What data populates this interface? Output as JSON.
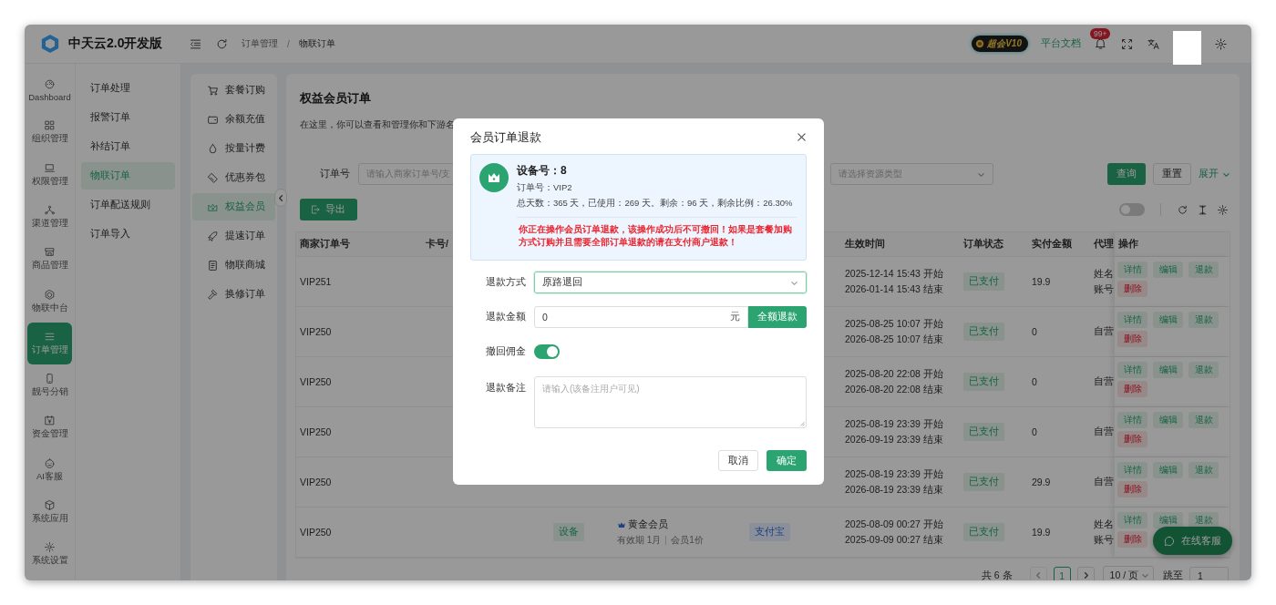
{
  "app": {
    "title": "中天云2.0开发版"
  },
  "header": {
    "breadcrumb": [
      "订单管理",
      "物联订单"
    ],
    "breadcrumb_separator": "/",
    "vip_badge": "超会V10",
    "docs_link": "平台文档",
    "notification_count": "99+"
  },
  "nav": [
    {
      "label": "Dashboard",
      "selected": false
    },
    {
      "label": "组织管理",
      "selected": false
    },
    {
      "label": "权限管理",
      "selected": false
    },
    {
      "label": "渠道管理",
      "selected": false
    },
    {
      "label": "商品管理",
      "selected": false
    },
    {
      "label": "物联中台",
      "selected": false
    },
    {
      "label": "订单管理",
      "selected": true
    },
    {
      "label": "靓号分销",
      "selected": false
    },
    {
      "label": "资金管理",
      "selected": false
    },
    {
      "label": "AI客服",
      "selected": false
    },
    {
      "label": "系统应用",
      "selected": false
    },
    {
      "label": "系统设置",
      "selected": false
    }
  ],
  "submenu": [
    {
      "label": "订单处理",
      "selected": false
    },
    {
      "label": "报警订单",
      "selected": false
    },
    {
      "label": "补结订单",
      "selected": false
    },
    {
      "label": "物联订单",
      "selected": true
    },
    {
      "label": "订单配送规则",
      "selected": false
    },
    {
      "label": "订单导入",
      "selected": false
    }
  ],
  "order_types": [
    {
      "label": "套餐订购",
      "selected": false
    },
    {
      "label": "余额充值",
      "selected": false
    },
    {
      "label": "按量计费",
      "selected": false
    },
    {
      "label": "优惠券包",
      "selected": false
    },
    {
      "label": "权益会员",
      "selected": true
    },
    {
      "label": "提速订单",
      "selected": false
    },
    {
      "label": "物联商城",
      "selected": false
    },
    {
      "label": "换修订单",
      "selected": false
    }
  ],
  "page": {
    "title": "权益会员订单",
    "description": "在这里，你可以查看和管理你和下游名"
  },
  "filters": {
    "order_label": "订单号",
    "order_placeholder": "请输入商家订单号/支",
    "resource_placeholder": "请选择资源类型",
    "search_button": "查询",
    "reset_button": "重置",
    "expand_link": "展开"
  },
  "toolbar": {
    "export_button": "导出",
    "toggle_on": false
  },
  "table": {
    "columns": {
      "order_no": "商家订单号",
      "card_no": "卡号/",
      "effective_time": "生效时间",
      "status": "订单状态",
      "paid": "实付金额",
      "agent": "代理",
      "actions": "操作"
    },
    "rows": [
      {
        "order_no": "VIP251",
        "start": "2025-12-14 15:43 开始",
        "end": "2026-01-14 15:43 结束",
        "status": "已支付",
        "paid": "19.9",
        "agent": [
          "姓名",
          "账号"
        ],
        "actions": [
          {
            "label": "详情",
            "kind": "normal"
          },
          {
            "label": "编辑",
            "kind": "normal"
          },
          {
            "label": "退款",
            "kind": "normal"
          },
          {
            "label": "删除",
            "kind": "danger"
          }
        ]
      },
      {
        "order_no": "VIP250",
        "start": "2025-08-25 10:07 开始",
        "end": "2026-08-25 10:07 结束",
        "status": "已支付",
        "paid": "0",
        "agent": [
          "自营"
        ],
        "actions": [
          {
            "label": "详情",
            "kind": "normal"
          },
          {
            "label": "编辑",
            "kind": "normal"
          },
          {
            "label": "退款",
            "kind": "normal"
          },
          {
            "label": "删除",
            "kind": "danger"
          }
        ]
      },
      {
        "order_no": "VIP250",
        "start": "2025-08-20 22:08 开始",
        "end": "2026-08-20 22:08 结束",
        "status": "已支付",
        "paid": "0",
        "agent": [
          "自营"
        ],
        "actions": [
          {
            "label": "详情",
            "kind": "normal"
          },
          {
            "label": "编辑",
            "kind": "normal"
          },
          {
            "label": "退款",
            "kind": "normal"
          },
          {
            "label": "删除",
            "kind": "danger"
          }
        ]
      },
      {
        "order_no": "VIP250",
        "start": "2025-08-19 23:39 开始",
        "end": "2026-09-19 23:39 结束",
        "status": "已支付",
        "paid": "0",
        "agent": [
          "自营"
        ],
        "actions": [
          {
            "label": "详情",
            "kind": "normal"
          },
          {
            "label": "编辑",
            "kind": "normal"
          },
          {
            "label": "退款",
            "kind": "normal"
          },
          {
            "label": "删除",
            "kind": "danger"
          }
        ]
      },
      {
        "order_no": "VIP250",
        "start": "2025-08-19 23:39 开始",
        "end": "2026-08-19 23:39 结束",
        "status": "已支付",
        "paid": "29.9",
        "agent": [
          "自营"
        ],
        "actions": [
          {
            "label": "详情",
            "kind": "normal"
          },
          {
            "label": "编辑",
            "kind": "normal"
          },
          {
            "label": "退款",
            "kind": "normal"
          },
          {
            "label": "删除",
            "kind": "danger"
          }
        ]
      },
      {
        "order_no": "VIP250",
        "type": "设备",
        "package": {
          "name": "黄金会员",
          "validity": "有效期 1月",
          "price": "会员1价"
        },
        "payment": "支付宝",
        "start": "2025-08-09 00:27 开始",
        "end": "2025-09-09 00:27 结束",
        "status": "已支付",
        "paid": "19.9",
        "agent": [
          "姓名",
          "账号"
        ],
        "actions": [
          {
            "label": "详情",
            "kind": "normal"
          },
          {
            "label": "编辑",
            "kind": "normal"
          },
          {
            "label": "退款",
            "kind": "normal"
          },
          {
            "label": "删除",
            "kind": "danger"
          }
        ]
      }
    ]
  },
  "pagination": {
    "total": "共 6 条",
    "pages": [
      {
        "label": "1",
        "selected": true
      }
    ],
    "page_size": "10 / 页",
    "jump_label": "跳至",
    "jump_value": "1"
  },
  "chat_button": "在线客服",
  "modal": {
    "title": "会员订单退款",
    "device_label": "设备号：8",
    "order_label": "订单号：VIP2",
    "stats": "总天数：365 天，已使用：269 天。剩余：96 天，剩余比例：26.30%",
    "warning": "你正在操作会员订单退款，该操作成功后不可撤回！如果是套餐加购方式订购并且需要全部订单退款的请在支付商户退款！",
    "fields": [
      {
        "kind": "select",
        "label": "退款方式",
        "value": "原路退回",
        "focused": true
      },
      {
        "kind": "amount",
        "label": "退款金额",
        "value": "0",
        "suffix": "元",
        "button": "全额退款"
      },
      {
        "kind": "switch",
        "label": "撤回佣金",
        "on": true
      },
      {
        "kind": "textarea",
        "label": "退款备注",
        "placeholder": "请输入(该备注用户可见)"
      }
    ],
    "cancel": "取消",
    "confirm": "确定"
  }
}
